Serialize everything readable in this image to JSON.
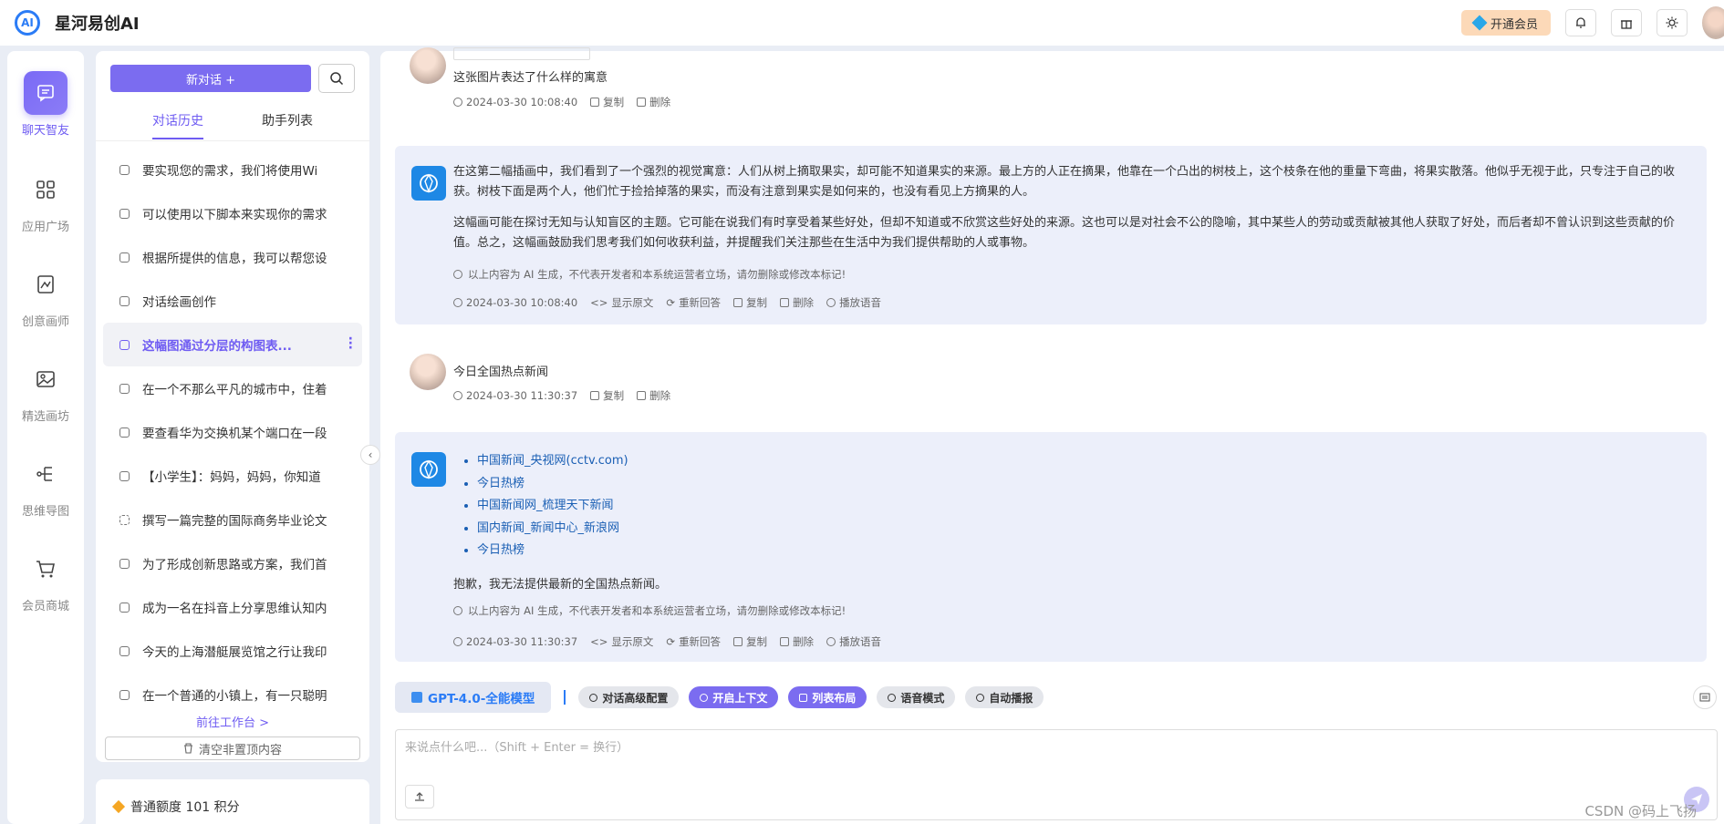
{
  "app": {
    "title": "星河易创AI"
  },
  "header": {
    "vip_label": "开通会员"
  },
  "rail": [
    {
      "label": "聊天智友",
      "icon": "chat-icon"
    },
    {
      "label": "应用广场",
      "icon": "grid-icon"
    },
    {
      "label": "创意画师",
      "icon": "draw-icon"
    },
    {
      "label": "精选画坊",
      "icon": "gallery-icon"
    },
    {
      "label": "思维导图",
      "icon": "mindmap-icon"
    },
    {
      "label": "会员商城",
      "icon": "cart-icon"
    }
  ],
  "history": {
    "new_chat_label": "新对话 +",
    "tabs": [
      "对话历史",
      "助手列表"
    ],
    "items": [
      "要实现您的需求，我们将使用Wi",
      "可以使用以下脚本来实现你的需求",
      "根据所提供的信息，我可以帮您设",
      "对话绘画创作",
      "这幅图通过分层的构图表...",
      "在一个不那么平凡的城市中，住着",
      "要查看华为交换机某个端口在一段",
      "【小学生】：妈妈，妈妈，你知道",
      "撰写一篇完整的国际商务毕业论文",
      "为了形成创新思路或方案，我们首",
      "成为一名在抖音上分享思维认知内",
      "今天的上海潜艇展览馆之行让我印",
      "在一个普通的小镇上，有一只聪明"
    ],
    "goto_workspace": "前往工作台 >",
    "clear_label": "清空非置顶内容"
  },
  "credits": {
    "label": "普通额度 101 积分"
  },
  "messages": {
    "m1": {
      "text": "这张图片表达了什么样的寓意",
      "time": "2024-03-30 10:08:40",
      "copy": "复制",
      "delete": "删除"
    },
    "m2": {
      "p1": "在这第二幅插画中，我们看到了一个强烈的视觉寓意：人们从树上摘取果实，却可能不知道果实的来源。最上方的人正在摘果，他靠在一个凸出的树枝上，这个枝条在他的重量下弯曲，将果实散落。他似乎无视于此，只专注于自己的收获。树枝下面是两个人，他们忙于捡拾掉落的果实，而没有注意到果实是如何来的，也没有看见上方摘果的人。",
      "p2": "这幅画可能在探讨无知与认知盲区的主题。它可能在说我们有时享受着某些好处，但却不知道或不欣赏这些好处的来源。这也可以是对社会不公的隐喻，其中某些人的劳动或贡献被其他人获取了好处，而后者却不曾认识到这些贡献的价值。总之，这幅画鼓励我们思考我们如何收获利益，并提醒我们关注那些在生活中为我们提供帮助的人或事物。",
      "disclaimer": "以上内容为 AI 生成，不代表开发者和本系统运营者立场，请勿删除或修改本标记!",
      "time": "2024-03-30 10:08:40",
      "show_raw": "显示原文",
      "regenerate": "重新回答",
      "copy": "复制",
      "delete": "删除",
      "play": "播放语音"
    },
    "m3": {
      "text": "今日全国热点新闻",
      "time": "2024-03-30 11:30:37",
      "copy": "复制",
      "delete": "删除"
    },
    "m4": {
      "links": [
        "中国新闻_央视网(cctv.com)",
        "今日热榜",
        "中国新闻网_梳理天下新闻",
        "国内新闻_新闻中心_新浪网",
        "今日热榜"
      ],
      "answer": "抱歉，我无法提供最新的全国热点新闻。",
      "disclaimer": "以上内容为 AI 生成，不代表开发者和本系统运营者立场，请勿删除或修改本标记!",
      "time": "2024-03-30 11:30:37",
      "show_raw": "显示原文",
      "regenerate": "重新回答",
      "copy": "复制",
      "delete": "删除",
      "play": "播放语音"
    }
  },
  "toolbar": {
    "model": "GPT-4.0-全能模型",
    "advanced": "对话高级配置",
    "context": "开启上下文",
    "layout": "列表布局",
    "voice_mode": "语音模式",
    "auto_play": "自动播报"
  },
  "input": {
    "placeholder": "来说点什么吧...（Shift + Enter = 换行）"
  },
  "watermark": "CSDN @码上飞扬",
  "colors": {
    "accent": "#6f5cf2",
    "ai_bubble": "#eceffa",
    "vip": "#fcd9b8"
  }
}
